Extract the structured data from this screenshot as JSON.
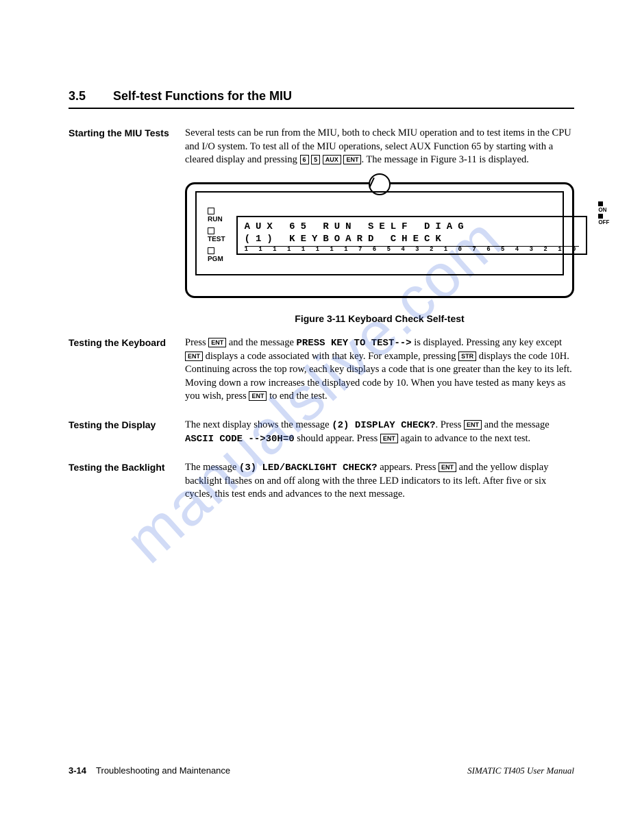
{
  "section": {
    "number": "3.5",
    "title": "Self-test Functions for the MIU"
  },
  "blocks": {
    "starting": {
      "label": "Starting the MIU Tests",
      "p1a": "Several tests can be run from the MIU, both to check MIU operation and to test items in the CPU and I/O system. To test all of the MIU operations, select AUX Function 65 by starting with a cleared display and pressing ",
      "k1": "6",
      "k2": "5",
      "k3": "AUX",
      "k4": "ENT",
      "p1b": ". The message in Figure 3-11 is displayed."
    },
    "keyboard": {
      "label": "Testing the Keyboard",
      "p_a": "Press ",
      "k1": "ENT",
      "p_b": " and the message ",
      "tt1": "PRESS KEY TO TEST-->",
      "p_c": " is displayed. Pressing any key except ",
      "k2": "ENT",
      "p_d": " displays a code associated with that key. For example, pressing ",
      "k3": "STR",
      "p_e": " displays the code 10H. Continuing across the top row, each key displays a code that is one greater than the key to its left. Moving down a row increases the displayed code by 10. When you have tested as many keys as you wish, press ",
      "k4": "ENT",
      "p_f": " to end the test."
    },
    "display": {
      "label": "Testing the Display",
      "p_a": "The next display shows the message ",
      "tt1": "(2) DISPLAY CHECK?",
      "p_b": ". Press ",
      "k1": "ENT",
      "p_c": " and the message ",
      "tt2": "ASCII CODE -->30H=0",
      "p_d": " should appear. Press ",
      "k2": "ENT",
      "p_e": " again to advance to the next test."
    },
    "backlight": {
      "label": "Testing the Backlight",
      "p_a": "The message ",
      "tt1": "(3) LED/BACKLIGHT CHECK?",
      "p_b": " appears. Press ",
      "k1": "ENT",
      "p_c": " and the yellow display backlight flashes on and off along with the three LED indicators to its left. After five or six cycles, this test ends and advances to the next message."
    }
  },
  "figure": {
    "leds": {
      "run": "RUN",
      "test": "TEST",
      "pgm": "PGM"
    },
    "lcd_line1": "AUX 65 RUN SELF DIAG",
    "lcd_line2": "(1) KEYBOARD CHECK",
    "ticks": "1 1 1 1 1 1 1 1 7 6 5 4 3 2 1 0 7 6 5 4 3 2 1 0",
    "onoff": {
      "on": "ON",
      "off": "OFF"
    },
    "caption": "Figure 3-11   Keyboard Check Self-test"
  },
  "footer": {
    "page": "3-14",
    "chapter": "Troubleshooting and Maintenance",
    "manual": "SIMATIC TI405 User Manual"
  },
  "watermark": "manualslive.com"
}
